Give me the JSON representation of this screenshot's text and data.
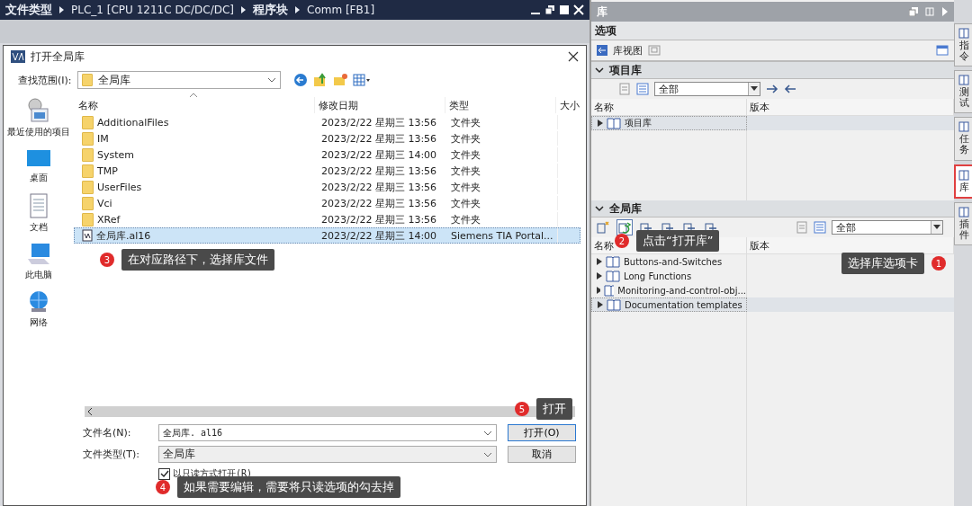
{
  "breadcrumb": [
    "文件类型",
    "PLC_1 [CPU 1211C DC/DC/DC]",
    "程序块",
    "Comm [FB1]"
  ],
  "dialog": {
    "title": "打开全局库",
    "look_in_label": "查找范围(I):",
    "look_in_value": "全局库",
    "places": [
      {
        "label": "最近使用的项目",
        "kind": "recent"
      },
      {
        "label": "桌面",
        "kind": "desktop"
      },
      {
        "label": "文档",
        "kind": "documents"
      },
      {
        "label": "此电脑",
        "kind": "computer"
      },
      {
        "label": "网络",
        "kind": "network"
      }
    ],
    "columns": [
      "名称",
      "修改日期",
      "类型",
      "大小"
    ],
    "files": [
      {
        "name": "AdditionalFiles",
        "date": "2023/2/22 星期三 13:56",
        "type": "文件夹",
        "kind": "folder",
        "selected": false
      },
      {
        "name": "IM",
        "date": "2023/2/22 星期三 13:56",
        "type": "文件夹",
        "kind": "folder",
        "selected": false
      },
      {
        "name": "System",
        "date": "2023/2/22 星期三 14:00",
        "type": "文件夹",
        "kind": "folder",
        "selected": false
      },
      {
        "name": "TMP",
        "date": "2023/2/22 星期三 13:56",
        "type": "文件夹",
        "kind": "folder",
        "selected": false
      },
      {
        "name": "UserFiles",
        "date": "2023/2/22 星期三 13:56",
        "type": "文件夹",
        "kind": "folder",
        "selected": false
      },
      {
        "name": "Vci",
        "date": "2023/2/22 星期三 13:56",
        "type": "文件夹",
        "kind": "folder",
        "selected": false
      },
      {
        "name": "XRef",
        "date": "2023/2/22 星期三 13:56",
        "type": "文件夹",
        "kind": "folder",
        "selected": false
      },
      {
        "name": "全局库.al16",
        "date": "2023/2/22 星期三 14:00",
        "type": "Siemens TIA Portal...",
        "kind": "library",
        "selected": true
      }
    ],
    "filename_label": "文件名(N):",
    "filename_value": "全局库. al16",
    "filetype_label": "文件类型(T):",
    "filetype_value": "全局库",
    "readonly": {
      "label": "以只读方式打开(R)",
      "checked": true
    },
    "buttons": [
      "打开(O)",
      "取消"
    ]
  },
  "library_panel": {
    "title": "库",
    "options_title": "选项",
    "library_view_label": "库视图",
    "project_library": {
      "title": "项目库",
      "expanded": true,
      "filter": "全部",
      "columns": [
        "名称",
        "版本"
      ],
      "items": [
        {
          "name": "项目库",
          "selected": true
        }
      ]
    },
    "global_library": {
      "title": "全局库",
      "expanded": true,
      "filter": "全部",
      "columns": [
        "名称",
        "版本"
      ],
      "items": [
        {
          "name": "Buttons-and-Switches",
          "selected": false
        },
        {
          "name": "Long Functions",
          "selected": false
        },
        {
          "name": "Monitoring-and-control-obj...",
          "selected": false
        },
        {
          "name": "Documentation templates",
          "selected": true
        }
      ]
    }
  },
  "side_tabs": [
    {
      "label": "指令",
      "selected": false
    },
    {
      "label": "测试",
      "selected": false
    },
    {
      "label": "任务",
      "selected": false
    },
    {
      "label": "库",
      "selected": true
    },
    {
      "label": "插件",
      "selected": false
    }
  ],
  "callouts": [
    {
      "number": "1",
      "text": "选择库选项卡"
    },
    {
      "number": "2",
      "text": "点击“打开库”"
    },
    {
      "number": "3",
      "text": "在对应路径下，选择库文件"
    },
    {
      "number": "4",
      "text": "如果需要编辑，需要将只读选项的勾去掉"
    },
    {
      "number": "5",
      "text": "打开"
    }
  ]
}
